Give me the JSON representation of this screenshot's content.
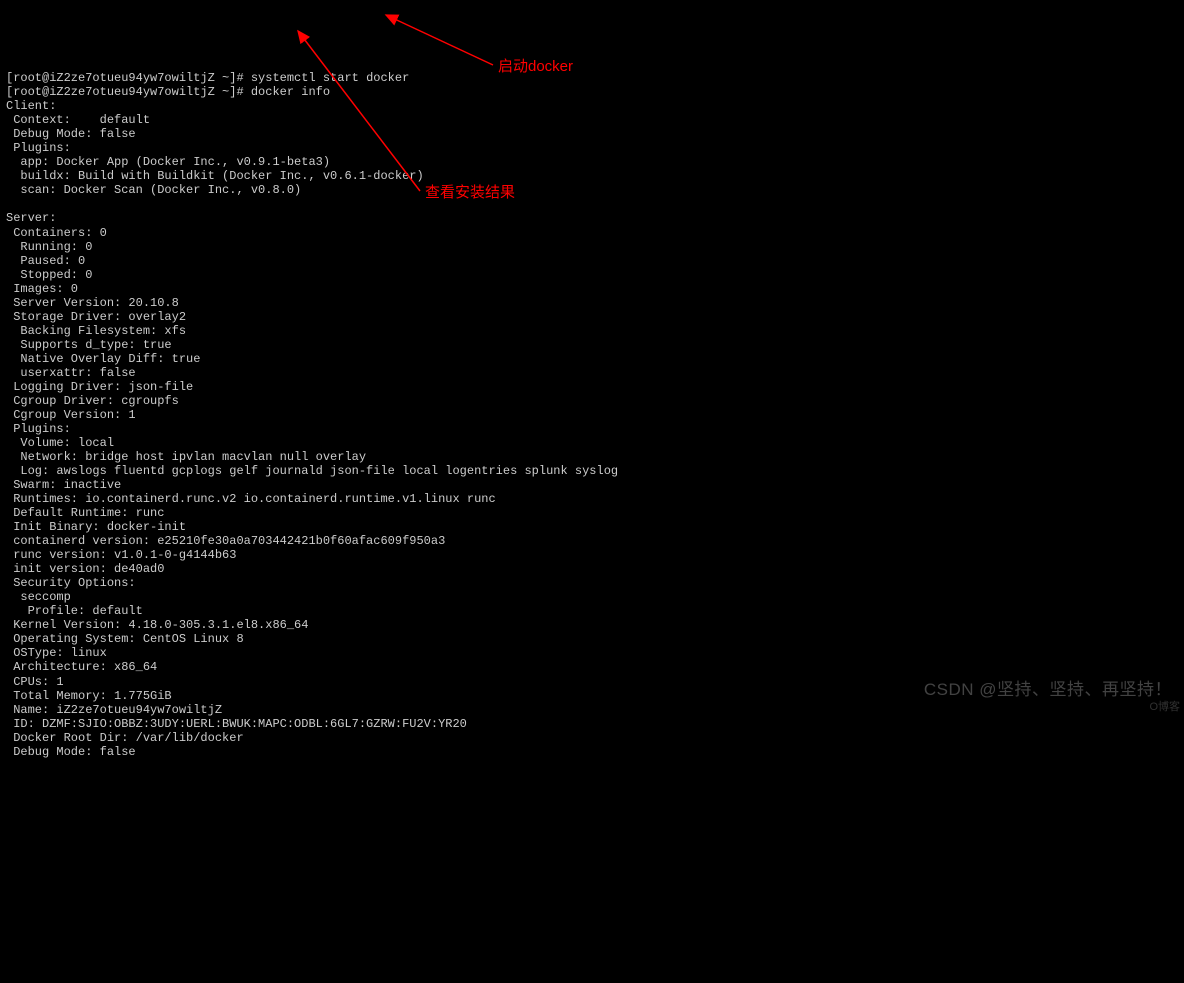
{
  "terminal": {
    "prompt": "[root@iZ2ze7otueu94yw7owiltjZ ~]# ",
    "cmd1": "systemctl start docker",
    "cmd2": "docker info",
    "lines": [
      "Client:",
      " Context:    default",
      " Debug Mode: false",
      " Plugins:",
      "  app: Docker App (Docker Inc., v0.9.1-beta3)",
      "  buildx: Build with Buildkit (Docker Inc., v0.6.1-docker)",
      "  scan: Docker Scan (Docker Inc., v0.8.0)",
      "",
      "Server:",
      " Containers: 0",
      "  Running: 0",
      "  Paused: 0",
      "  Stopped: 0",
      " Images: 0",
      " Server Version: 20.10.8",
      " Storage Driver: overlay2",
      "  Backing Filesystem: xfs",
      "  Supports d_type: true",
      "  Native Overlay Diff: true",
      "  userxattr: false",
      " Logging Driver: json-file",
      " Cgroup Driver: cgroupfs",
      " Cgroup Version: 1",
      " Plugins:",
      "  Volume: local",
      "  Network: bridge host ipvlan macvlan null overlay",
      "  Log: awslogs fluentd gcplogs gelf journald json-file local logentries splunk syslog",
      " Swarm: inactive",
      " Runtimes: io.containerd.runc.v2 io.containerd.runtime.v1.linux runc",
      " Default Runtime: runc",
      " Init Binary: docker-init",
      " containerd version: e25210fe30a0a703442421b0f60afac609f950a3",
      " runc version: v1.0.1-0-g4144b63",
      " init version: de40ad0",
      " Security Options:",
      "  seccomp",
      "   Profile: default",
      " Kernel Version: 4.18.0-305.3.1.el8.x86_64",
      " Operating System: CentOS Linux 8",
      " OSType: linux",
      " Architecture: x86_64",
      " CPUs: 1",
      " Total Memory: 1.775GiB",
      " Name: iZ2ze7otueu94yw7owiltjZ",
      " ID: DZMF:SJIO:OBBZ:3UDY:UERL:BWUK:MAPC:ODBL:6GL7:GZRW:FU2V:YR20",
      " Docker Root Dir: /var/lib/docker",
      " Debug Mode: false"
    ]
  },
  "annotations": {
    "label1": "启动docker",
    "label2": "查看安装结果"
  },
  "watermark": {
    "right": "CSDN @坚持、坚持、再坚持！",
    "corner": "O博客"
  }
}
